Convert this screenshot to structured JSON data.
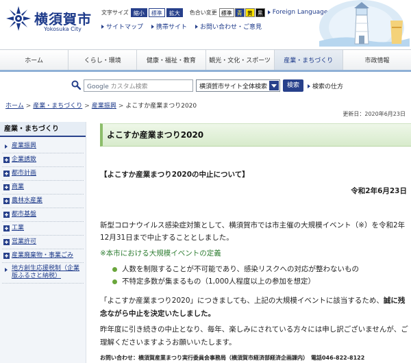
{
  "header": {
    "logo_name": "横須賀市",
    "logo_sub": "Yokosuka City",
    "font_size_label": "文字サイズ",
    "font_size_buttons": [
      "縮小",
      "標準",
      "拡大"
    ],
    "color_label": "色合い変更",
    "color_buttons": [
      "標準",
      "青",
      "黄",
      "黒"
    ],
    "foreign_languages": "Foreign Languages",
    "links": [
      "サイトマップ",
      "携帯サイト",
      "お問い合わせ・ご意見"
    ]
  },
  "nav": {
    "items": [
      "ホーム",
      "くらし・環境",
      "健康・福祉・教育",
      "観光・文化・スポーツ",
      "産業・まちづくり",
      "市政情報"
    ],
    "active_index": 4
  },
  "search": {
    "placeholder": "カスタム検索",
    "placeholder_brand": "Google",
    "scope": "横須賀市サイト全体検索",
    "button": "検索",
    "howto": "検索の仕方"
  },
  "breadcrumb": {
    "items": [
      "ホーム",
      "産業・まちづくり",
      "産業振興"
    ],
    "current": "よこすか産業まつり2020"
  },
  "updated": "更新日：2020年6月23日",
  "sidebar": {
    "heading": "産業・まちづくり",
    "items": [
      {
        "label": "産業振興",
        "icon": "arrow"
      },
      {
        "label": "企業誘致",
        "icon": "plus"
      },
      {
        "label": "都市計画",
        "icon": "plus"
      },
      {
        "label": "商業",
        "icon": "plus"
      },
      {
        "label": "農林水産業",
        "icon": "plus"
      },
      {
        "label": "都市基盤",
        "icon": "plus"
      },
      {
        "label": "工業",
        "icon": "plus"
      },
      {
        "label": "営業許可",
        "icon": "plus"
      },
      {
        "label": "産業廃棄物・事業ごみ",
        "icon": "plus"
      },
      {
        "label": "地方創生応援税制（企業版ふるさと納税）",
        "icon": "arrow"
      }
    ]
  },
  "article": {
    "title": "よこすか産業まつり2020",
    "heading": "【よこすか産業まつり2020の中止について】",
    "date": "令和2年6月23日",
    "para1": "新型コロナウイルス感染症対策として、横須賀市では市主催の大規模イベント（※）を令和2年12月31日まで中止することとしました。",
    "note": "※本市における大規模イベントの定義",
    "bullets": [
      "人数を制限することが不可能であり、感染リスクへの対応が整わないもの",
      "不特定多数が集まるもの（1,000人程度以上の参加を想定）"
    ],
    "para2_normal": "「よこすか産業まつり2020」につきましても、上記の大規模イベントに該当するため、",
    "para2_bold": "誠に残念ながら中止を決定いたしました。",
    "para3": "昨年度に引き続きの中止となり、毎年、楽しみにされている方々には申し訳ございませんが、ご理解くださいますようお願いいたします。",
    "contact": "お問い合わせ：横須賀産業まつり実行委員会事務局（横須賀市経済部経済企画課内）　電話046-822-8122"
  },
  "colors": {
    "brand": "#27408b",
    "title_bar": "#d8ebcc",
    "note_green": "#2e7d32"
  }
}
